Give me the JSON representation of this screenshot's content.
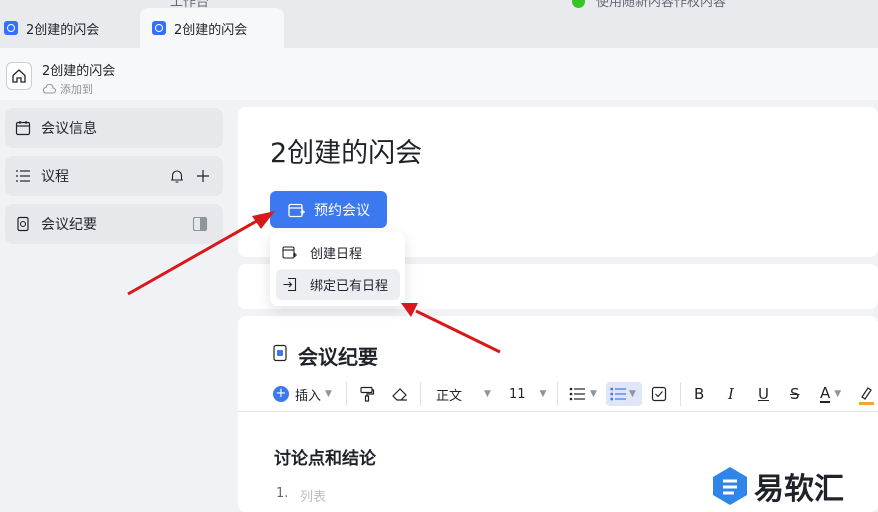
{
  "tabs": [
    {
      "label": "2创建的闪会",
      "active": false
    },
    {
      "label": "2创建的闪会",
      "active": true
    }
  ],
  "top_truncated": {
    "left_text": "工作台",
    "right_text": "使用随新内容作权内容"
  },
  "header": {
    "title": "2创建的闪会",
    "subtitle": "添加到"
  },
  "sidebar": {
    "items": [
      {
        "label": "会议信息",
        "icon": "calendar-icon",
        "selected": true
      },
      {
        "label": "议程",
        "icon": "list-icon",
        "selected": false
      },
      {
        "label": "会议纪要",
        "icon": "doc-icon",
        "selected": true
      }
    ]
  },
  "main": {
    "title": "2创建的闪会",
    "schedule_button": "预约会议",
    "dropdown": {
      "items": [
        {
          "label": "创建日程",
          "icon": "calendar-add-icon",
          "hovered": false
        },
        {
          "label": "绑定已有日程",
          "icon": "bind-icon",
          "hovered": true
        }
      ]
    },
    "minutes": {
      "title": "会议纪要",
      "toolbar": {
        "insert": "插入",
        "style": "正文",
        "font_size": "11",
        "bold": "B",
        "italic": "I",
        "underline": "U",
        "strike": "S",
        "font_color": "A"
      },
      "heading": "讨论点和结论",
      "list_number": "1.",
      "list_placeholder": "列表"
    }
  },
  "watermark": {
    "text": "易软汇"
  },
  "colors": {
    "accent": "#3c78f0",
    "arrow": "#d7191c",
    "background": "#f1f2f5"
  }
}
